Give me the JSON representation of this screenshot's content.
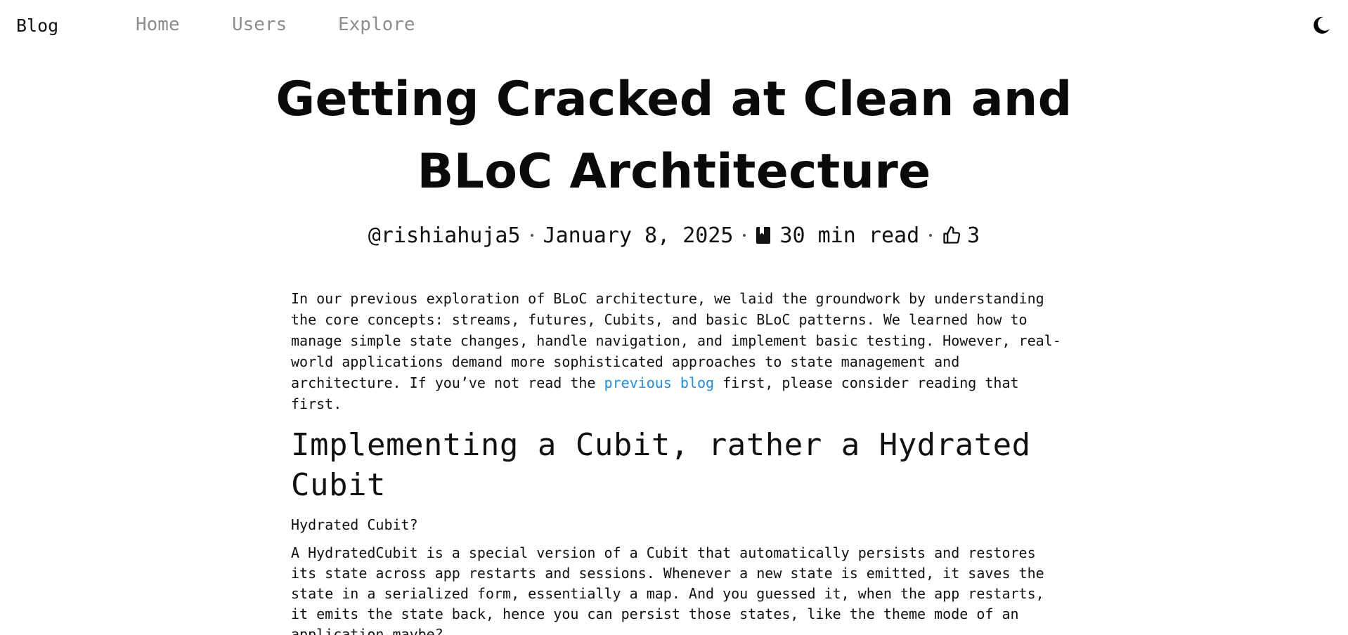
{
  "nav": {
    "brand": "Blog",
    "links": [
      "Home",
      "Users",
      "Explore"
    ],
    "theme_icon": "moon-icon"
  },
  "post": {
    "title_line1": "Getting Cracked at Clean and",
    "title_line2": "BLoC Archtitecture",
    "author": "@rishiahuja5",
    "date": "January 8, 2025",
    "read_time": "30 min read",
    "read_icon": "book-icon",
    "likes": "3",
    "like_icon": "thumbs-up-icon"
  },
  "article": {
    "intro_before_link": "In our previous exploration of BLoC architecture, we laid the groundwork by understanding the core concepts: streams, futures, Cubits, and basic BLoC patterns. We learned how to manage simple state changes, handle navigation, and implement basic testing. However, real-world applications demand more sophisticated approaches to state management and architecture. If you’ve not read the ",
    "intro_link": "previous blog",
    "intro_after_link": " first, please consider reading that first.",
    "heading": "Implementing a Cubit, rather a Hydrated Cubit",
    "subheading": "Hydrated Cubit?",
    "paragraph2": "A HydratedCubit is a special version of a Cubit that automatically persists and restores its state across app restarts and sessions. Whenever a new state is emitted, it saves the state in a serialized form, essentially a map. And you guessed it, when the app restarts, it emits the state back, hence you can persist those states, like the theme mode of an application maybe?"
  },
  "colors": {
    "link": "#1a8fe3",
    "nav_inactive": "#8e8e8e",
    "text": "#111111"
  }
}
